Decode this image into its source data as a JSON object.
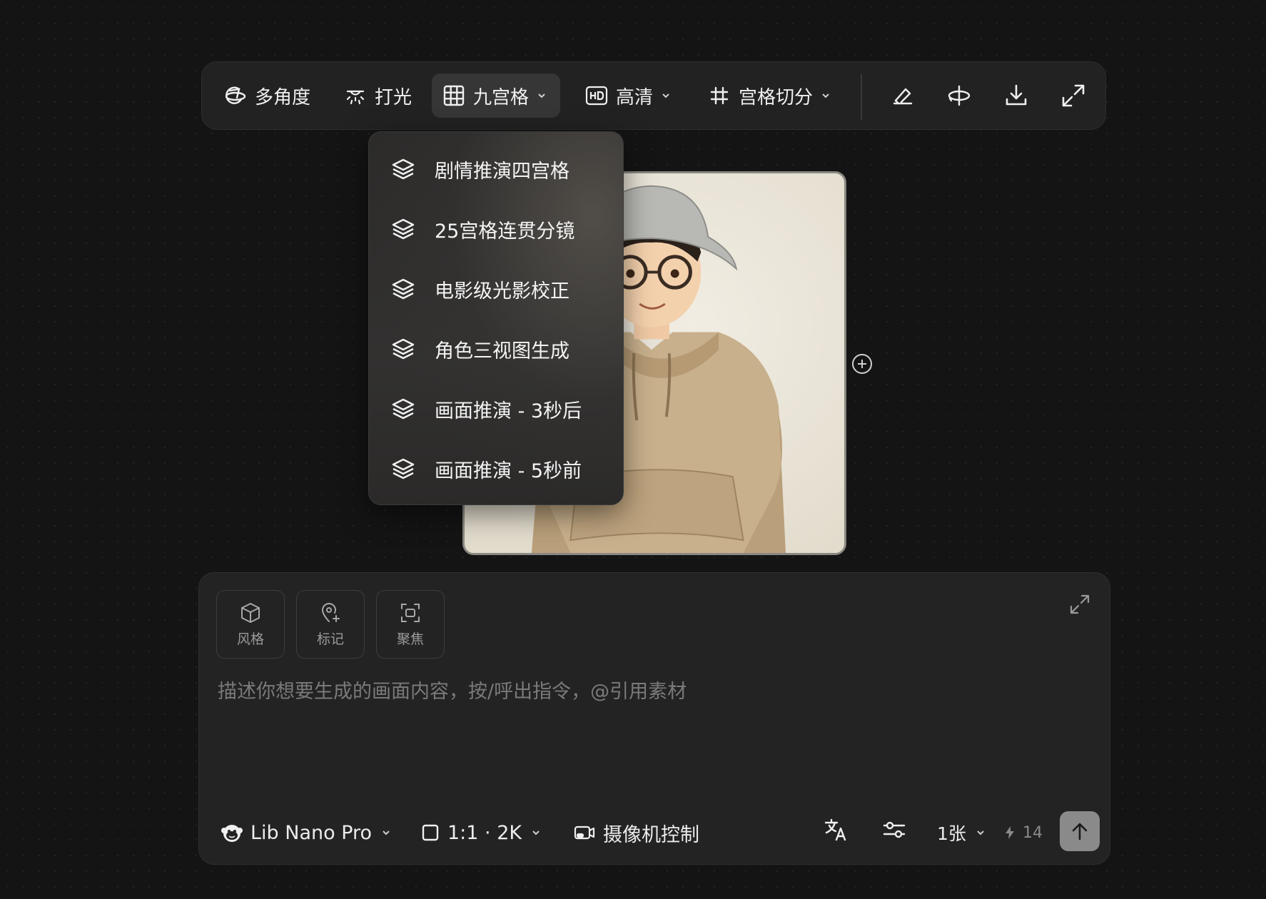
{
  "toolbar": {
    "multi_angle": "多角度",
    "lighting": "打光",
    "grid": "九宫格",
    "hd": "高清",
    "grid_split": "宫格切分"
  },
  "dropdown": {
    "items": [
      {
        "label": "剧情推演四宫格"
      },
      {
        "label": "25宫格连贯分镜"
      },
      {
        "label": "电影级光影校正"
      },
      {
        "label": "角色三视图生成"
      },
      {
        "label": "画面推演 - 3秒后"
      },
      {
        "label": "画面推演 - 5秒前"
      }
    ]
  },
  "panel": {
    "tools": [
      {
        "label": "风格"
      },
      {
        "label": "标记"
      },
      {
        "label": "聚焦"
      }
    ],
    "prompt_placeholder": "描述你想要生成的画面内容，按/呼出指令，@引用素材",
    "model": "Lib Nano Pro",
    "aspect": "1:1 · 2K",
    "camera": "摄像机控制",
    "count": "1张",
    "credits": "14"
  },
  "colors": {
    "background": "#141414",
    "panel": "#232323",
    "accent_active": "#363636",
    "send_button": "#8a8a8a"
  }
}
